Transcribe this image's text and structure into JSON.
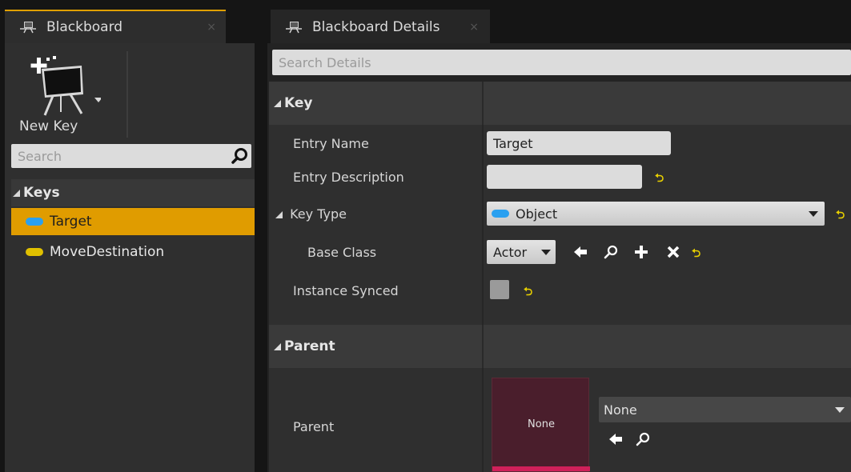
{
  "left_tab": {
    "title": "Blackboard",
    "close": "×"
  },
  "right_tab": {
    "title": "Blackboard Details",
    "close": "×"
  },
  "toolbar": {
    "new_key_label": "New Key"
  },
  "keys_search": {
    "placeholder": "Search"
  },
  "keys": {
    "header": "Keys",
    "items": [
      {
        "label": "Target",
        "pill_color": "#2aa0f0",
        "selected": true
      },
      {
        "label": "MoveDestination",
        "pill_color": "#e0c000",
        "selected": false
      }
    ]
  },
  "details_search": {
    "placeholder": "Search Details"
  },
  "key_category": {
    "header": "Key",
    "entry_name_label": "Entry Name",
    "entry_name_value": "Target",
    "entry_description_label": "Entry Description",
    "entry_description_value": "",
    "key_type_label": "Key Type",
    "key_type_value": "Object",
    "base_class_label": "Base Class",
    "base_class_value": "Actor",
    "instance_synced_label": "Instance Synced"
  },
  "parent_category": {
    "header": "Parent",
    "parent_label": "Parent",
    "thumbnail_label": "None",
    "parent_value": "None"
  },
  "colors": {
    "accent": "#e09c00",
    "reset_arrow": "#e8d000",
    "object_pill": "#2aa0f0",
    "vector_pill": "#e0c000",
    "asset_bar": "#d0205a"
  }
}
